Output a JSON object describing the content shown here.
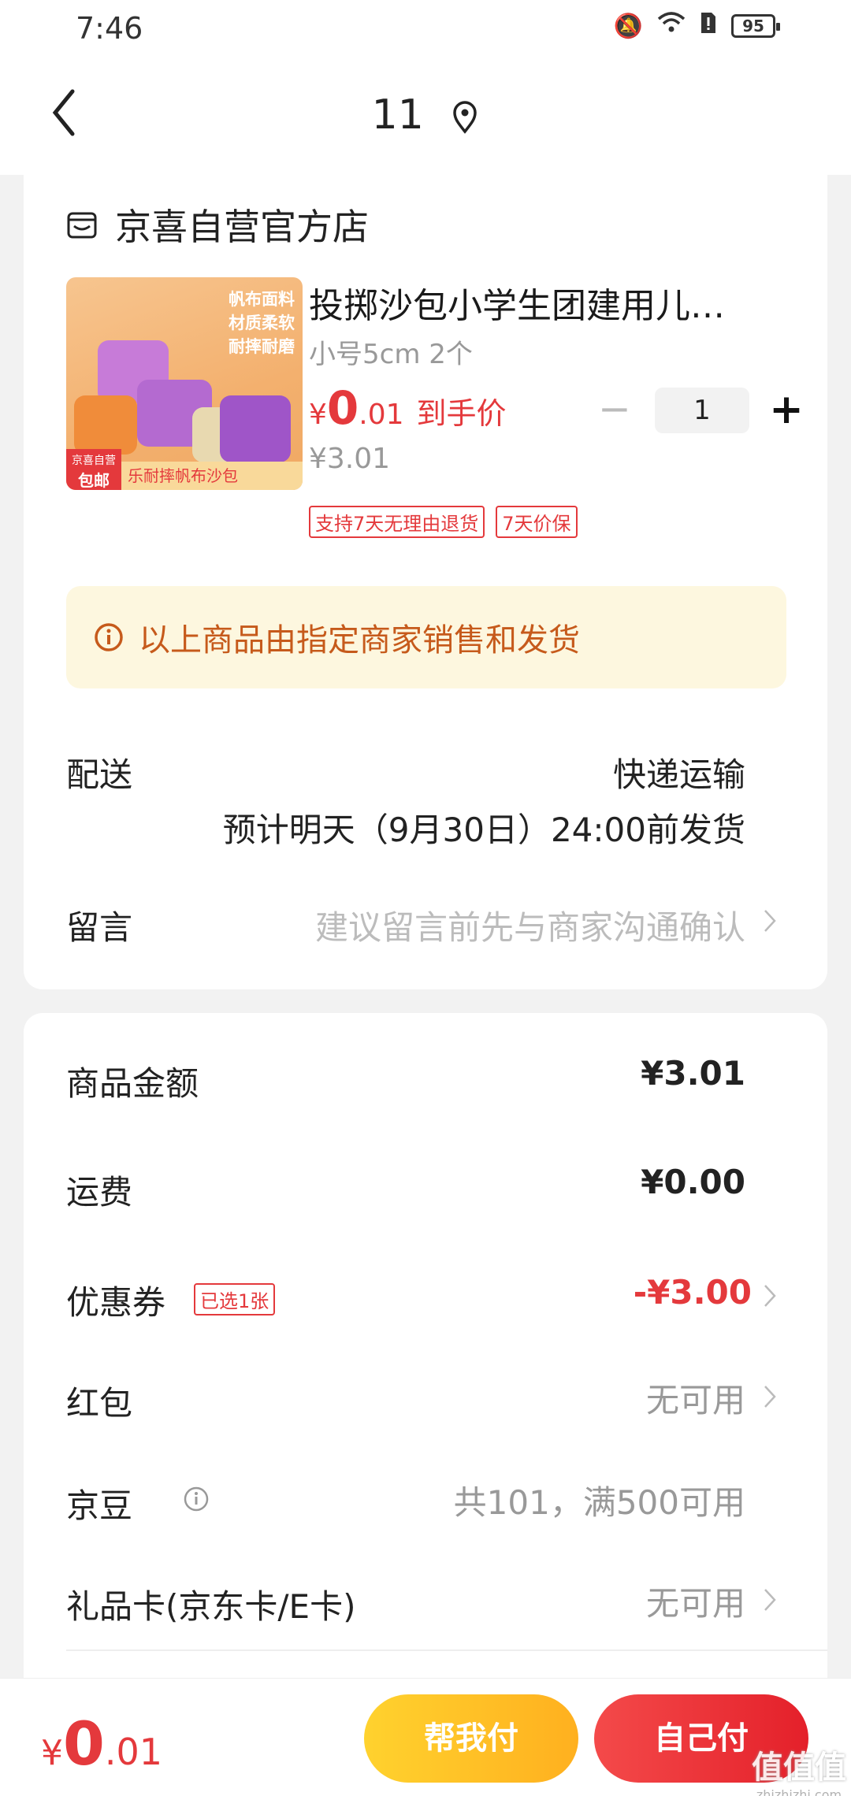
{
  "status_bar": {
    "time": "7:46",
    "battery": "95"
  },
  "nav": {
    "title": "11"
  },
  "shop": {
    "name": "京喜自营官方店"
  },
  "product": {
    "image_text": [
      "帆布面料",
      "材质柔软",
      "耐摔耐磨"
    ],
    "image_badge_top": "京喜自营",
    "image_badge": "包邮",
    "image_bottom_text": "乐耐摔帆布沙包",
    "title": "投掷沙包小学生团建用儿…",
    "spec": "小号5cm 2个",
    "price_symbol": "¥",
    "price_int": "0",
    "price_dec": ".01",
    "price_label": "到手价",
    "original_price": "¥3.01",
    "quantity": "1",
    "minus": "−",
    "plus": "+",
    "tags": [
      "支持7天无理由退货",
      "7天价保"
    ]
  },
  "notice": {
    "text": "以上商品由指定商家销售和发货"
  },
  "shipping": {
    "label": "配送",
    "method": "快递运输",
    "date": "预计明天（9月30日）24:00前发货"
  },
  "message": {
    "label": "留言",
    "placeholder": "建议留言前先与商家沟通确认"
  },
  "summary": {
    "goods_label": "商品金额",
    "goods_value": "¥3.01",
    "freight_label": "运费",
    "freight_value": "¥0.00",
    "coupon_label": "优惠券",
    "coupon_tag": "已选1张",
    "coupon_value": "-¥3.00",
    "redpacket_label": "红包",
    "redpacket_value": "无可用",
    "jingdou_label": "京豆",
    "jingdou_value": "共101，满500可用",
    "giftcard_label": "礼品卡(京东卡/E卡)",
    "giftcard_value": "无可用"
  },
  "bottom": {
    "total_symbol": "¥",
    "total_int": "0",
    "total_dec": ".01",
    "help_pay": "帮我付",
    "self_pay": "自己付",
    "watermark": "值值值",
    "watermark_small": "zhizhizhi.com"
  },
  "colors": {
    "accent_red": "#e4393c",
    "notice_bg": "#fdf7df",
    "notice_text": "#c65a1b",
    "help_btn": "#ffc226"
  }
}
